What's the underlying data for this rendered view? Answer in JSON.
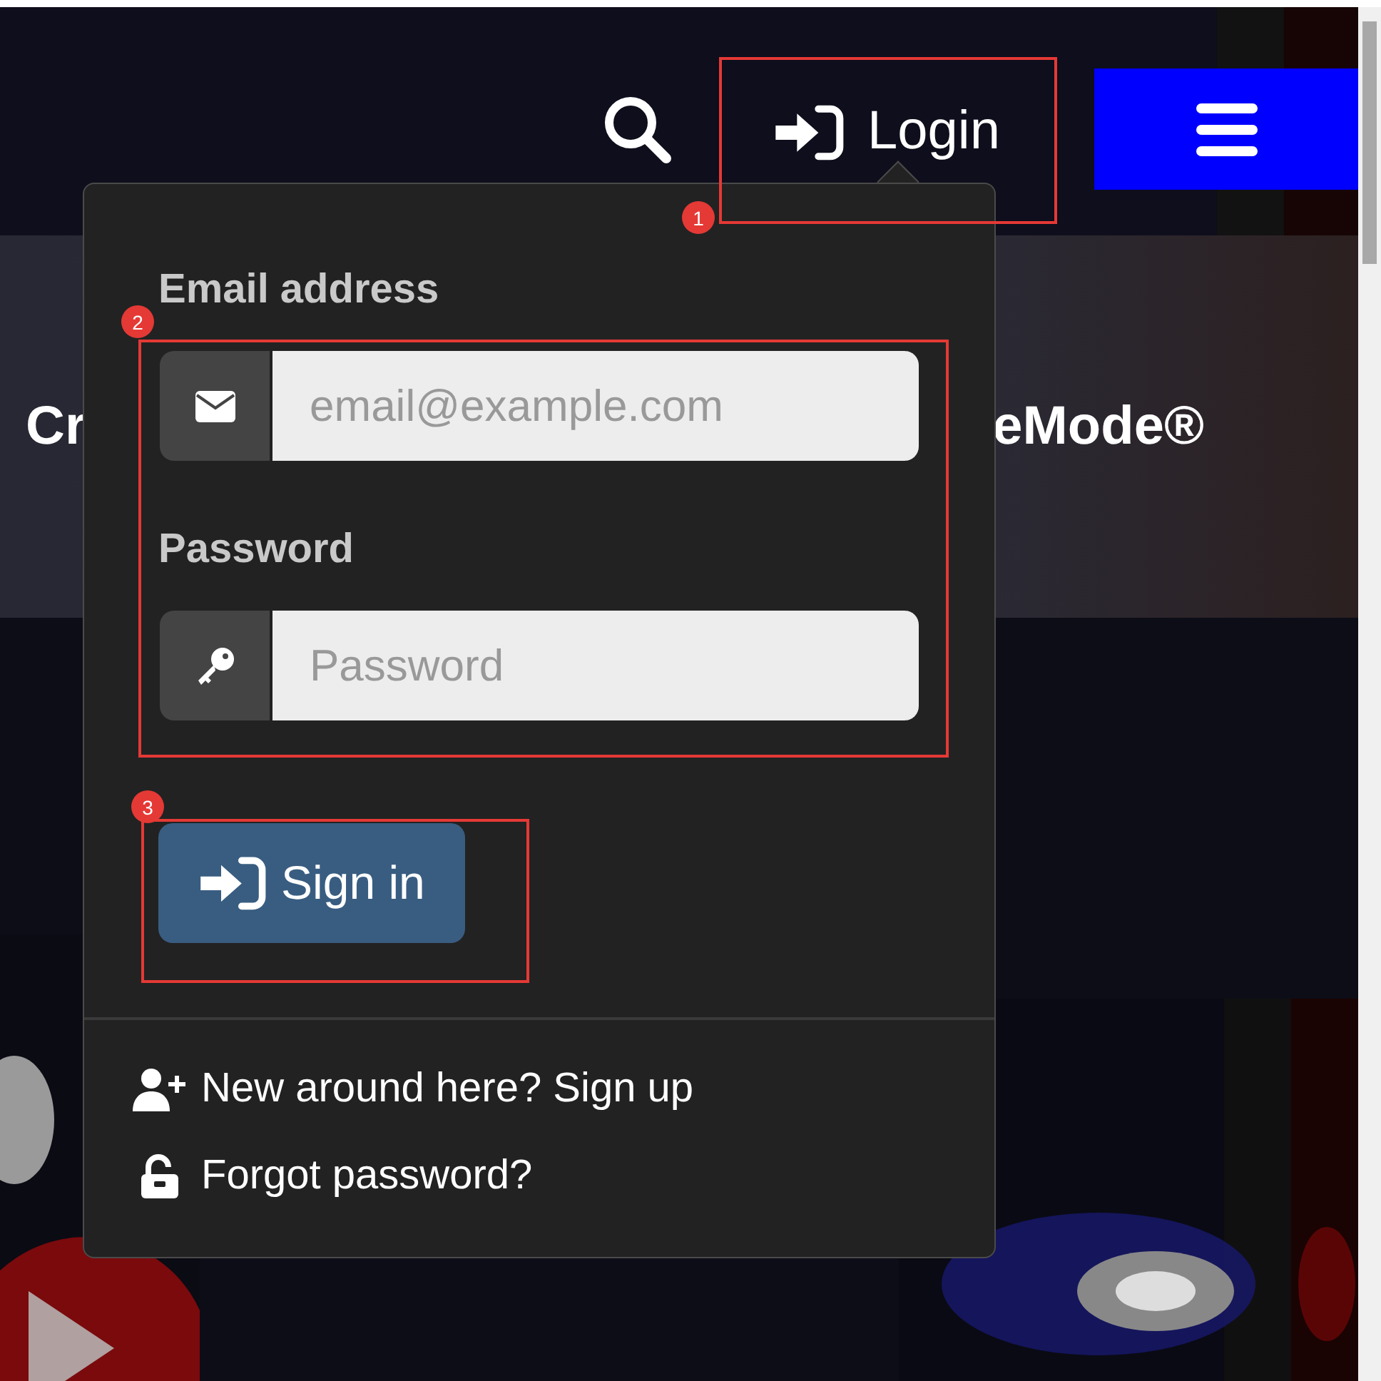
{
  "header": {
    "login_label": "Login"
  },
  "banner": {
    "title_start": "Cr",
    "title_end": "eMode®"
  },
  "login_popover": {
    "fields": [
      {
        "label": "Email address",
        "placeholder": "email@example.com",
        "kind": "email"
      },
      {
        "label": "Password",
        "placeholder": "Password",
        "kind": "password"
      }
    ],
    "submit": "Sign in",
    "links": [
      {
        "text": "New around here? Sign up",
        "kind": "signup"
      },
      {
        "text": "Forgot password?",
        "kind": "forgot"
      }
    ]
  },
  "annotations": [
    {
      "number": "1",
      "kind": "login"
    },
    {
      "number": "2",
      "kind": "fields"
    },
    {
      "number": "3",
      "kind": "submit"
    }
  ]
}
